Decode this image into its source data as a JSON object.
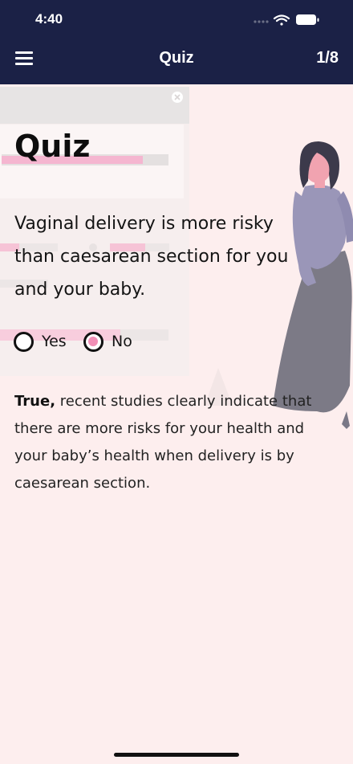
{
  "status_bar": {
    "time": "4:40",
    "icons": [
      "signal-dots-icon",
      "wifi-icon",
      "battery-icon"
    ]
  },
  "nav": {
    "title": "Quiz",
    "counter": "1/8",
    "menu_icon": "hamburger-menu-icon"
  },
  "quiz": {
    "heading": "Quiz",
    "question": "Vaginal delivery is more risky than caesarean section for you and your baby.",
    "options": [
      {
        "label": "Yes",
        "selected": false
      },
      {
        "label": "No",
        "selected": true
      }
    ],
    "answer_lead": "True,",
    "answer_text": "recent studies clearly indicate that there are more risks for your health and your baby’s health when delivery is by caesarean section."
  },
  "colors": {
    "nav_background": "#1b2146",
    "page_background": "#fdeeee",
    "accent_pink": "#f18fb6",
    "figure_top": "#9a96b8",
    "figure_skirt": "#6e6d7a"
  }
}
